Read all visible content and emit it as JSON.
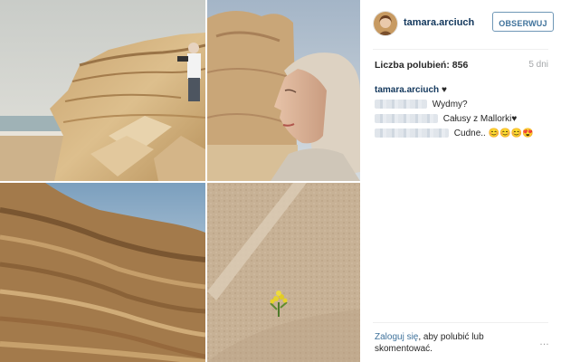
{
  "post": {
    "username": "tamara.arciuch",
    "follow_label": "OBSERWUJ",
    "likes_label": "Liczba polubień:",
    "likes_count": "856",
    "age": "5 dni",
    "caption": {
      "author": "tamara.arciuch",
      "heart": "♥",
      "lines": [
        {
          "text": "Wydmy?"
        },
        {
          "text": "Całusy z Mallorki♥"
        },
        {
          "text": "Cudne.. 😊😊😊😍"
        }
      ]
    },
    "footer": {
      "login_link": "Zaloguj się",
      "login_rest": ", aby polubić lub skomentować."
    },
    "more_icon": "…"
  },
  "icons": {
    "avatar": "avatar-image",
    "more": "more-options-icon"
  },
  "colors": {
    "link": "#3f729b",
    "username": "#12375c",
    "muted": "#a5a7aa"
  }
}
